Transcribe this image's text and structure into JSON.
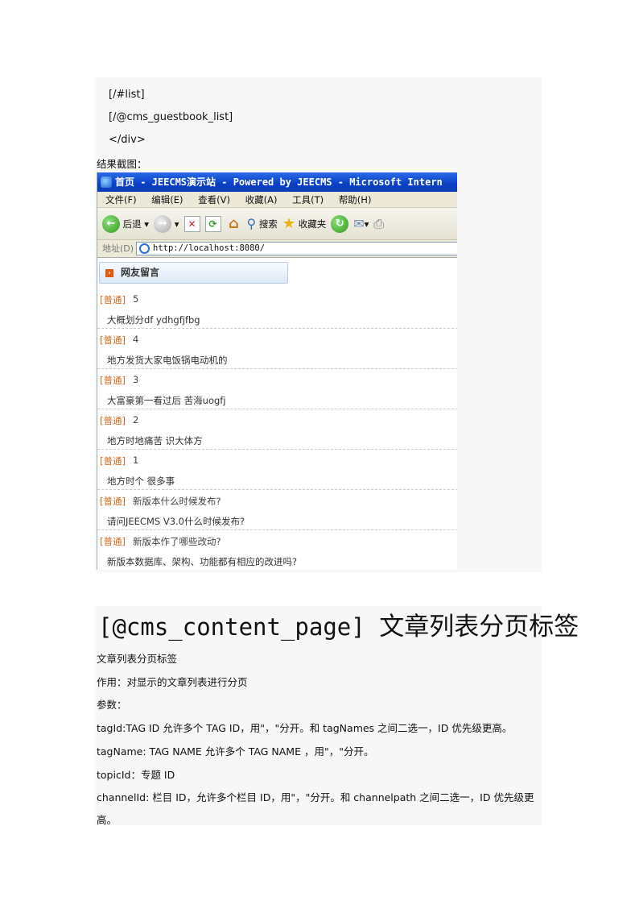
{
  "code_lines": [
    "[/#list]",
    "[/@cms_guestbook_list]",
    "</div>"
  ],
  "caption": "结果截图：",
  "browser": {
    "title": "首页 - JEECMS演示站 - Powered by JEECMS - Microsoft Intern",
    "menu": [
      "文件(F)",
      "编辑(E)",
      "查看(V)",
      "收藏(A)",
      "工具(T)",
      "帮助(H)"
    ],
    "back_label": "后退",
    "search_label": "搜索",
    "favorites_label": "收藏夹",
    "address_label": "地址(D)",
    "address_value": "http://localhost:8080/",
    "section_title": "网友留言",
    "items": [
      {
        "tag": "[普通]",
        "title": "5",
        "body": "大概划分df  ydhgfjfbg"
      },
      {
        "tag": "[普通]",
        "title": "4",
        "body": "地方发货大家电饭锅电动机的"
      },
      {
        "tag": "[普通]",
        "title": "3",
        "body": "大富豪第一看过后 苦海uogfj"
      },
      {
        "tag": "[普通]",
        "title": "2",
        "body": "地方时地痛苦 识大体方"
      },
      {
        "tag": "[普通]",
        "title": "1",
        "body": "地方时个 很多事"
      },
      {
        "tag": "[普通]",
        "title": "新版本什么时候发布?",
        "body": "请问JEECMS V3.0什么时候发布?"
      },
      {
        "tag": "[普通]",
        "title": "新版本作了哪些改动?",
        "body": "新版本数据库、架构、功能都有相应的改进吗?"
      }
    ]
  },
  "heading": {
    "code": "[@cms_content_page]",
    "cn": "文章列表分页标签"
  },
  "paragraphs": [
    "文章列表分页标签",
    "作用：对显示的文章列表进行分页",
    "参数：",
    "tagId:TAG ID  允许多个 TAG ID，用\"，\"分开。和 tagNames 之间二选一，ID 优先级更高。",
    "tagName:  TAG NAME  允许多个 TAG NAME  ，用\"，\"分开。",
    "topicId：专题 ID",
    "channelId: 栏目 ID，允许多个栏目 ID，用\"，\"分开。和 channelpath 之间二选一，ID 优先级更",
    "高。"
  ]
}
